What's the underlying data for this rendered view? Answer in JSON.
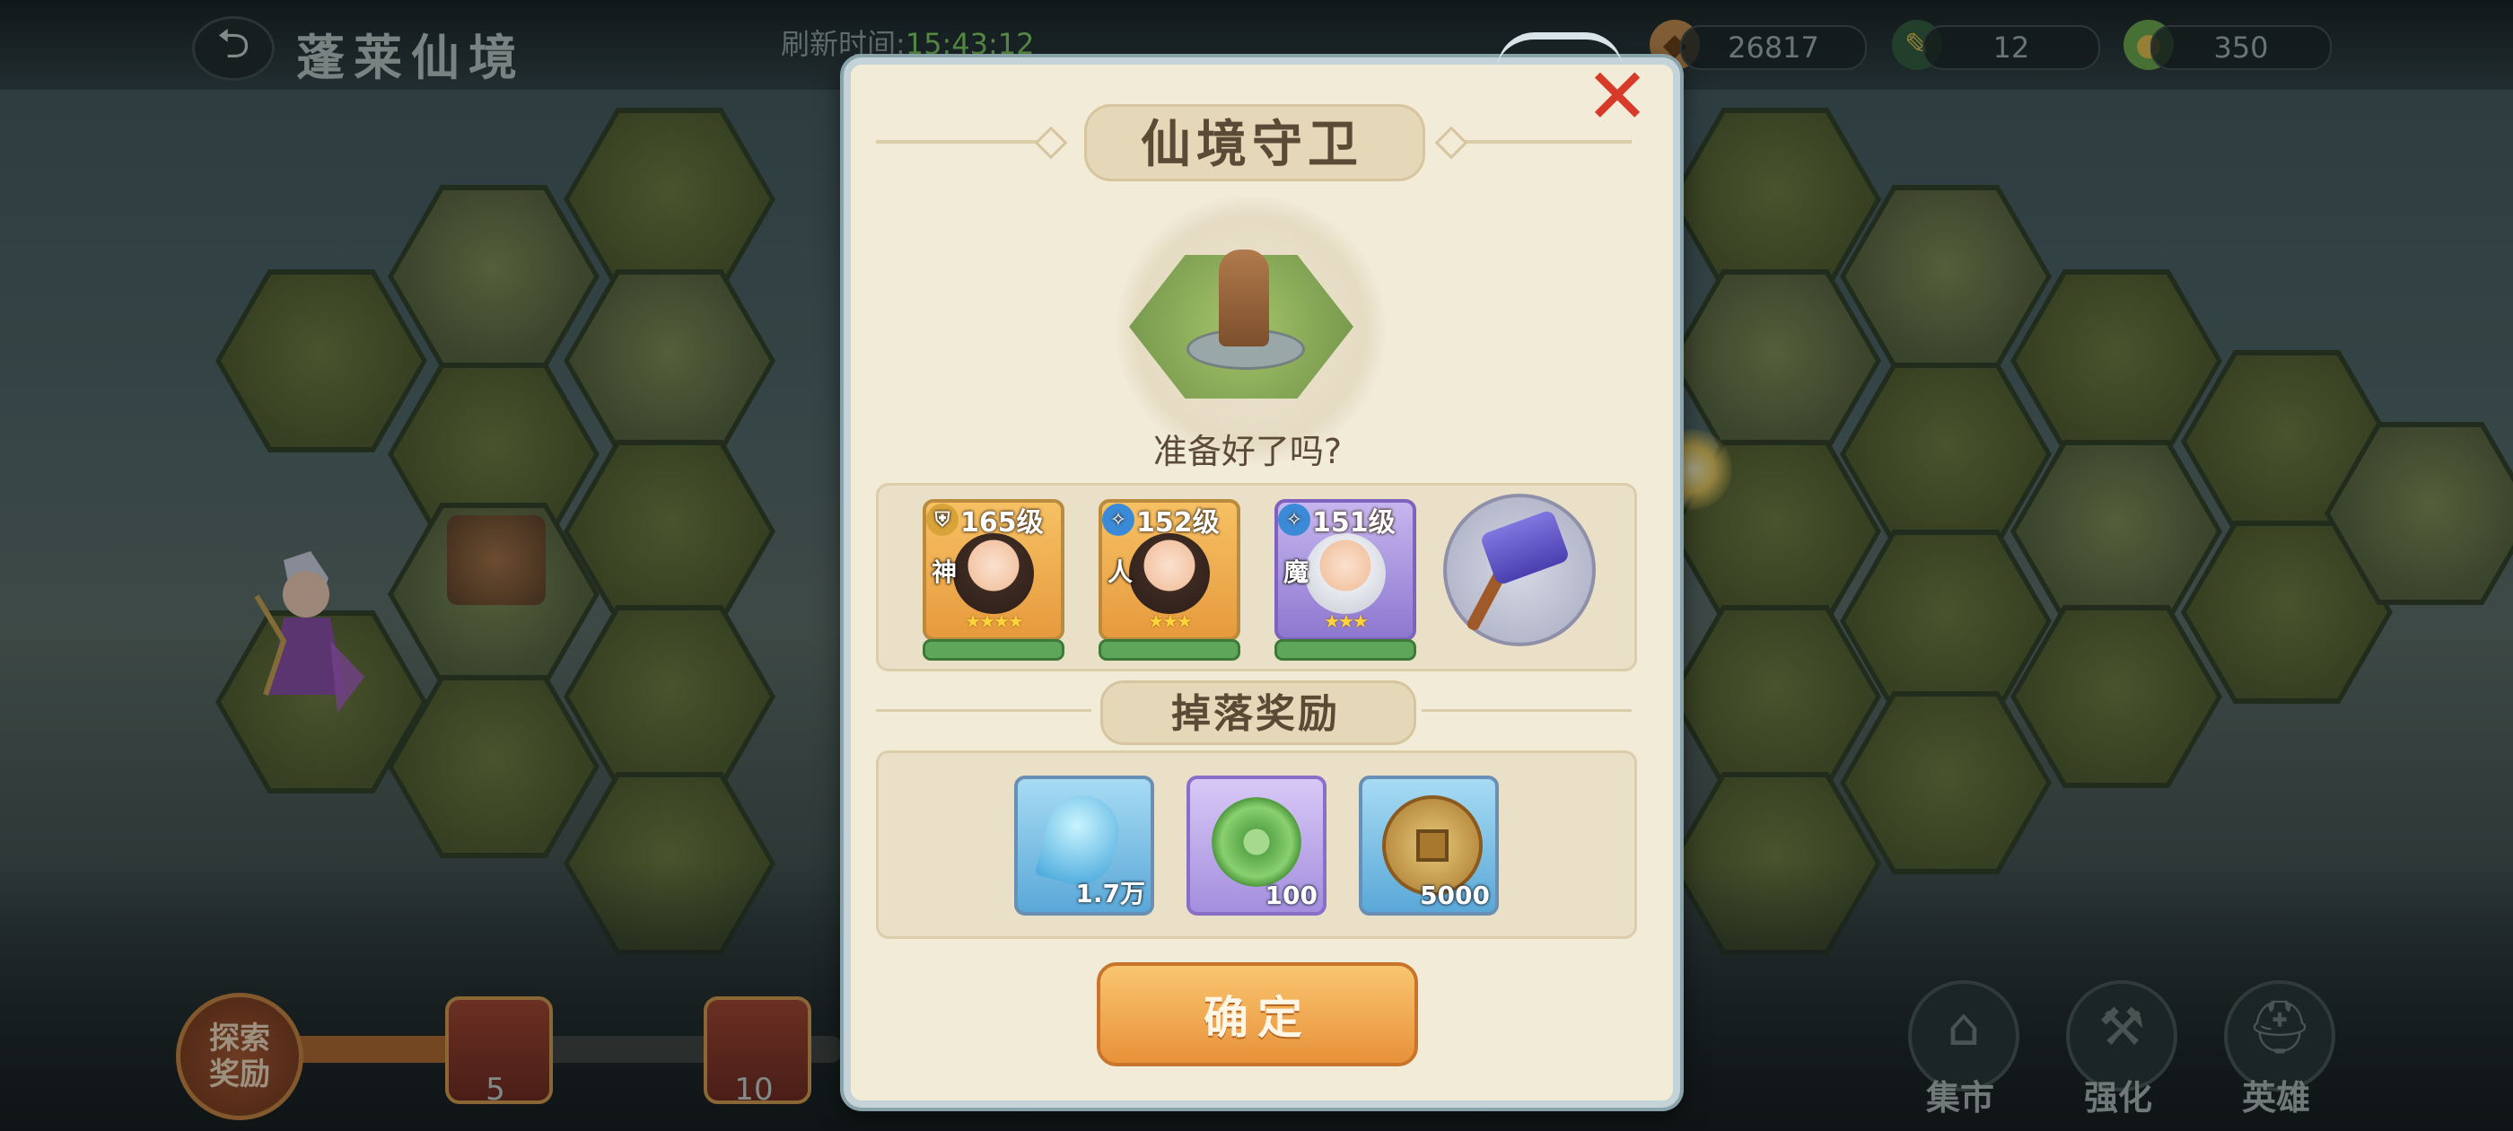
{
  "header": {
    "title": "蓬莱仙境",
    "refresh_label": "刷新时间:",
    "refresh_time": "15:43:12"
  },
  "resources": [
    {
      "icon": "pet-icon",
      "value": "26817"
    },
    {
      "icon": "feather-quill-icon",
      "value": "12"
    },
    {
      "icon": "jade-token-icon",
      "value": "350"
    }
  ],
  "bottom": {
    "explore_label": "探索奖励",
    "milestones": [
      "5",
      "10"
    ],
    "nav": [
      {
        "icon": "market-icon",
        "label": "集市"
      },
      {
        "icon": "hammer-icon",
        "label": "强化"
      },
      {
        "icon": "helmet-icon",
        "label": "英雄"
      }
    ]
  },
  "dialog": {
    "title": "仙境守卫",
    "prompt": "准备好了吗?",
    "team": [
      {
        "level": "165级",
        "faction": "神",
        "stars": "★★★★",
        "style": "gold"
      },
      {
        "level": "152级",
        "faction": "人",
        "stars": "★★★",
        "style": "gold"
      },
      {
        "level": "151级",
        "faction": "魔",
        "stars": "★★★",
        "style": "purple"
      }
    ],
    "artifact_icon": "purple-hammer-icon",
    "drop_title": "掉落奖励",
    "rewards": [
      {
        "icon": "water-drop-icon",
        "quantity": "1.7万"
      },
      {
        "icon": "jade-swirl-icon",
        "quantity": "100"
      },
      {
        "icon": "copper-coin-icon",
        "quantity": "5000"
      }
    ],
    "confirm_label": "确定",
    "close_glyph": "✕"
  },
  "colors": {
    "confirm": "#e8923a",
    "close": "#d83a2a",
    "dialog_bg": "#f2ebd8",
    "hp": "#5ea65a"
  }
}
